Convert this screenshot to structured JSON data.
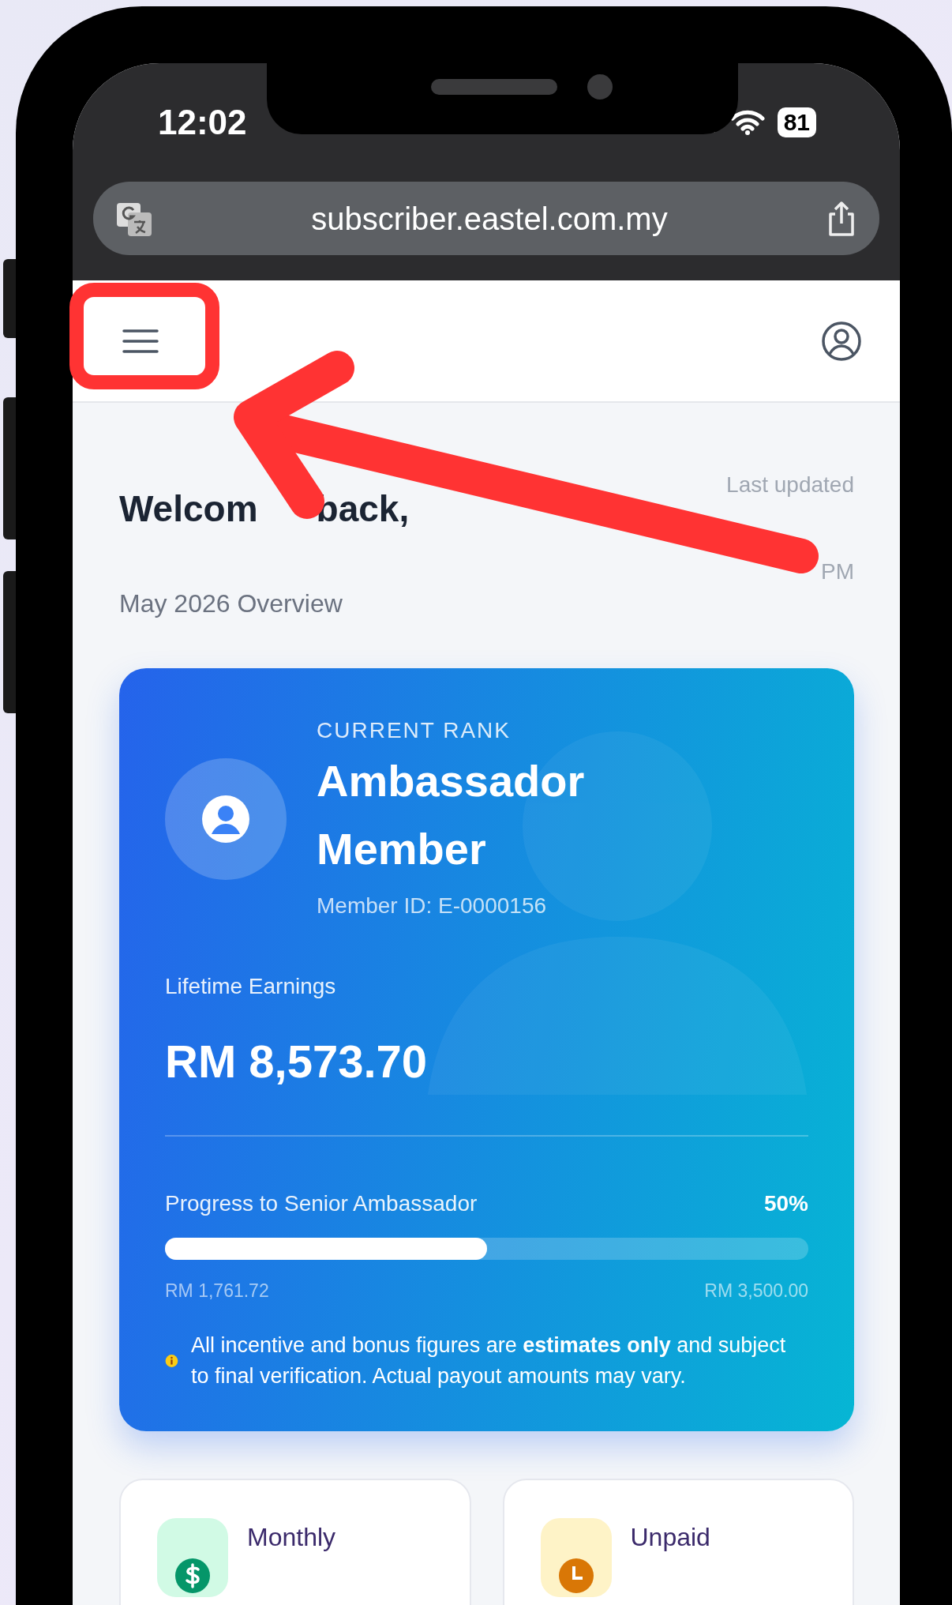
{
  "status_bar": {
    "time": "12:02",
    "battery": "81"
  },
  "browser": {
    "url": "subscriber.eastel.com.my"
  },
  "welcome": {
    "heading_parts": [
      "Welcom",
      "back,"
    ],
    "last_updated": "Last updated",
    "last_updated_end": "PM",
    "period": "May 2026 Overview"
  },
  "rank_card": {
    "eyebrow": "CURRENT RANK",
    "rank": "Ambassador Member",
    "member_id": "Member ID: E-0000156",
    "earnings_label": "Lifetime Earnings",
    "earnings": "RM 8,573.70",
    "progress": {
      "label": "Progress to Senior Ambassador",
      "percent": "50%",
      "level": 0.5,
      "from": "RM 1,761.72",
      "to": "RM 3,500.00"
    },
    "notice": "All incentive and bonus figures are **estimates only** and subject to final verification. Actual payout amounts may vary."
  },
  "stat_cards": [
    {
      "kind": "money",
      "label": "Monthly"
    },
    {
      "kind": "clock",
      "label": "Unpaid"
    }
  ]
}
